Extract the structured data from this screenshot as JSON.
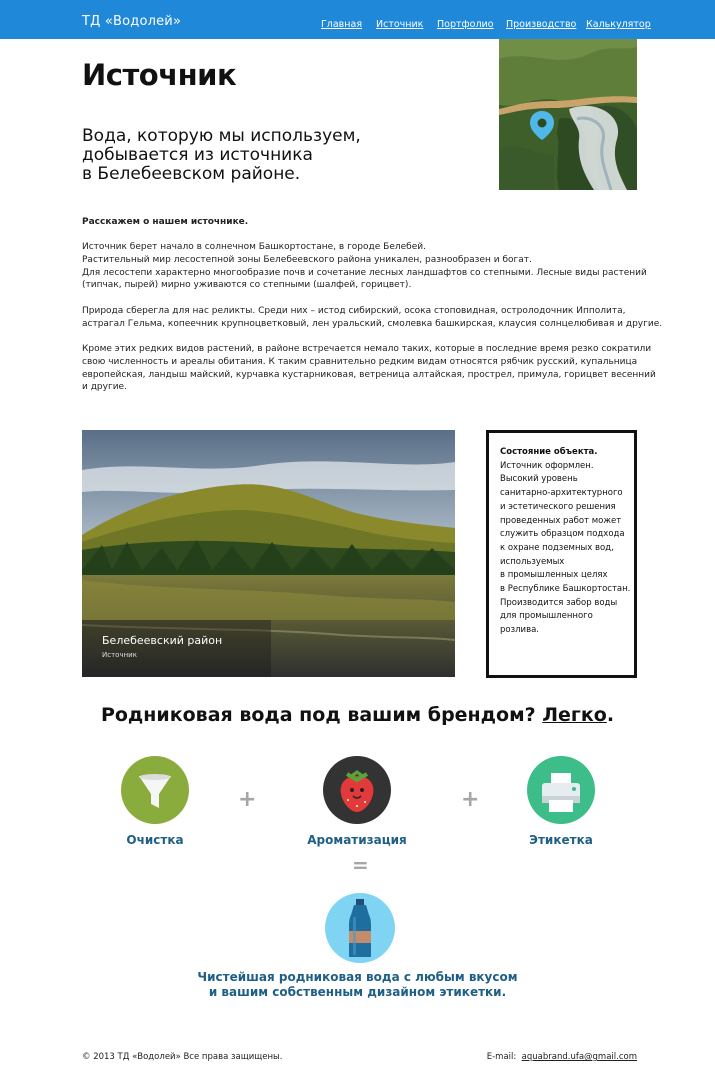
{
  "header": {
    "brand": "ТД «Водолей»",
    "nav": [
      "Главная",
      "Источник",
      "Портфолио",
      "Производство",
      "Калькулятор"
    ]
  },
  "page": {
    "title": "Источник",
    "lead": [
      "Вода, которую мы используем,",
      "добывается из источника",
      "в Белебеевском районе."
    ]
  },
  "article": {
    "intro": "Расскажем о нашем источнике.",
    "p1": [
      "Источник берет начало в солнечном Башкортостане, в городе Белебей.",
      "Растительный мир лесостепной зоны Белебеевского района уникален, разнообразен и богат.",
      "Для лесостепи характерно многообразие почв и сочетание лесных ландшафтов со степными. Лесные виды растений",
      "(типчак, пырей) мирно уживаются со степными (шалфей, горицвет)."
    ],
    "p2": [
      "Природа сберегла для нас реликты. Среди них – истод сибирский, осока стоповидная, остролодочник Ипполита,",
      "астрагал Гельма, копеечник крупноцветковый, лен уральский, смолевка башкирская, клаусия солнцелюбивая и другие."
    ],
    "p3": [
      "Кроме этих редких видов растений, в районе встречается немало таких, которые в последние время резко сократили",
      "свою численность и ареалы обитания. К таким сравнительно редким видам относятся рябчик русский, купальница",
      "европейская, ландыш майский, курчавка кустарниковая, ветреница алтайская, прострел, примула, горицвет весенний",
      "и другие."
    ]
  },
  "photo": {
    "caption_title": "Белебеевский район",
    "caption_sub": "Источник"
  },
  "status": {
    "heading": "Состояние объекта.",
    "lines": [
      "Источник оформлен.",
      "Высокий уровень",
      "санитарно-архитектурного",
      "и эстетического решения",
      "проведенных работ может",
      "служить образцом подхода",
      "к охране подземных вод,",
      "используемых",
      "в промышленных целях",
      "в Республике Башкортостан.",
      "Производится забор воды",
      "для промышленного",
      "розлива."
    ]
  },
  "brand_section": {
    "heading_text": "Родниковая вода под вашим брендом?",
    "heading_link": "Легко",
    "heading_tail": ".",
    "steps": [
      {
        "label": "Очистка",
        "icon": "funnel-icon",
        "color": "#8aac3c"
      },
      {
        "label": "Ароматизация",
        "icon": "strawberry-icon",
        "color": "#333333"
      },
      {
        "label": "Этикетка",
        "icon": "printer-icon",
        "color": "#3cbd8a"
      }
    ],
    "plus": "+",
    "equals": "=",
    "result_icon": "bottle-icon",
    "result_color": "#7fd3f3",
    "result": [
      "Чистейшая родниковая вода с любым вкусом",
      "и вашим собственным дизайном этикетки."
    ]
  },
  "footer": {
    "copyright": "© 2013 ТД «Водолей» Все права защищены.",
    "email_label": "E-mail:",
    "email": "aquabrand.ufa@gmail.com"
  },
  "colors": {
    "header_bg": "#1f88d8",
    "accent_text": "#1f5f86",
    "map_pin": "#4fb8e8"
  }
}
